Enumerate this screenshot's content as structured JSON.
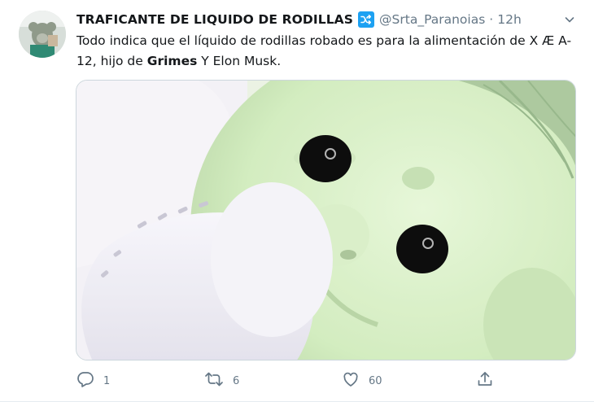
{
  "tweet": {
    "display_name": "TRAFICANTE DE LIQUIDO DE RODILLAS",
    "badge_icon": "shuffle-icon",
    "handle": "@Srta_Paranoias",
    "separator": "·",
    "time": "12h",
    "text_part1": "Todo indica que el líquido de rodillas robado es para la alimentación de X Æ A-12, hijo de ",
    "text_bold": "Grimes",
    "text_part2": " Y Elon Musk.",
    "media_alt": "Imagen"
  },
  "actions": {
    "reply_count": "1",
    "retweet_count": "6",
    "like_count": "60"
  },
  "colors": {
    "accent": "#1da1f2",
    "secondary_text": "#657786",
    "primary_text": "#14171a"
  },
  "icons": [
    "shuffle-icon",
    "chevron-down-icon",
    "reply-icon",
    "retweet-icon",
    "like-icon",
    "share-icon"
  ]
}
